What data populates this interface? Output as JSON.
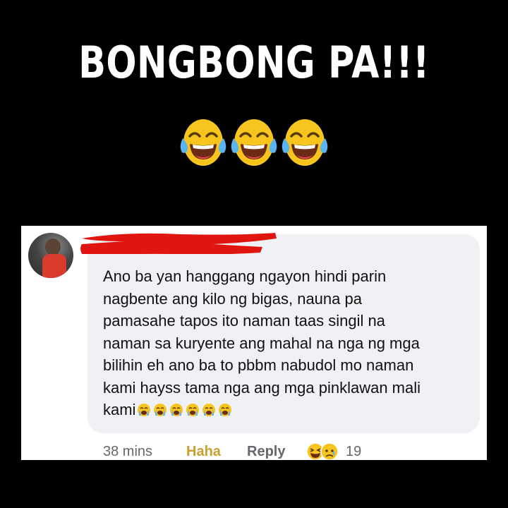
{
  "headline": "BONGBONG PA!!!",
  "headline_emojis": [
    "tears-of-joy-icon",
    "tears-of-joy-icon",
    "tears-of-joy-icon"
  ],
  "comment": {
    "lines": [
      "Ano ba yan hanggang ngayon hindi parin",
      "nagbente ang kilo ng bigas, nauna pa",
      "pamasahe tapos ito naman taas singil na",
      "naman sa kuryente ang mahal na nga ng mga",
      "bilihin eh ano ba to pbbm nabudol mo naman",
      "kami hayss tama nga ang mga pinklawan mali",
      "kami"
    ],
    "trailing_emojis": [
      "crying-face-icon",
      "crying-face-icon",
      "crying-face-icon",
      "crying-face-icon",
      "crying-face-icon",
      "crying-face-icon"
    ]
  },
  "footer": {
    "time": "38 mins",
    "haha": "Haha",
    "reply": "Reply",
    "reaction_icons": [
      "haha-reaction-icon",
      "sad-reaction-icon"
    ],
    "reaction_count": "19"
  },
  "colors": {
    "background": "#000000",
    "card": "#ffffff",
    "bubble": "#eff1f4",
    "haha": "#cba031",
    "meta": "#65676b",
    "redaction": "#e0150f"
  }
}
